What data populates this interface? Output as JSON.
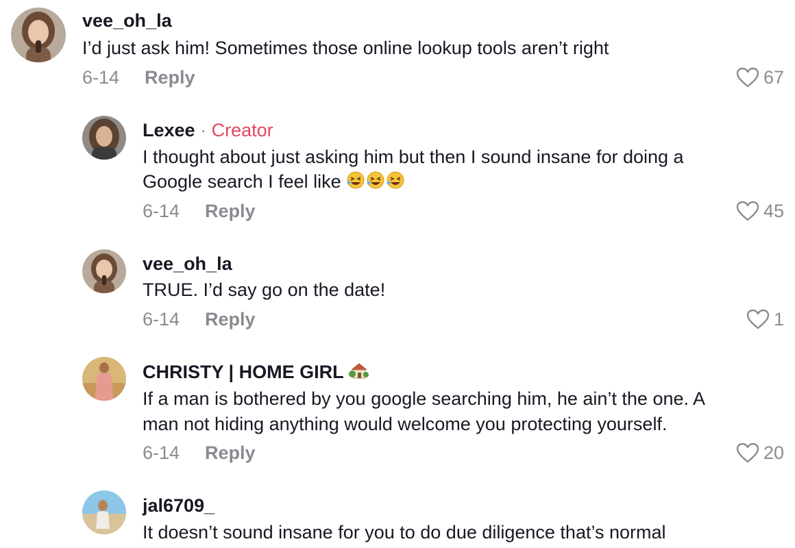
{
  "comments": [
    {
      "username": "vee_oh_la",
      "text": "I’d just ask him! Sometimes those online lookup tools aren’t right",
      "date": "6-14",
      "reply_label": "Reply",
      "likes": "67"
    },
    {
      "username": "Lexee",
      "separator": "·",
      "badge": "Creator",
      "text_line1": "I thought about just asking him but then I sound insane for doing a",
      "text_line2": "Google search I feel like",
      "emoji": "🤣🤣🤣",
      "date": "6-14",
      "reply_label": "Reply",
      "likes": "45"
    },
    {
      "username": "vee_oh_la",
      "text": "TRUE. I’d say go on the date!",
      "date": "6-14",
      "reply_label": "Reply",
      "likes": "1"
    },
    {
      "username": "CHRISTY | HOME GIRL",
      "username_emoji": "🏡",
      "text_line1": "If a man is bothered by you google searching him, he ain’t the one. A",
      "text_line2": "man not hiding anything would welcome you protecting yourself.",
      "date": "6-14",
      "reply_label": "Reply",
      "likes": "20"
    },
    {
      "username": "jal6709_",
      "text": "It doesn’t sound insane for you to do due diligence that’s normal"
    }
  ],
  "colors": {
    "primary_text": "#161823",
    "secondary_text": "#8a8b91",
    "creator_badge": "#e64660",
    "background": "#ffffff"
  },
  "icons": {
    "like": "heart-outline-icon",
    "laugh_emoji": "rolling-on-floor-laughing",
    "house_emoji": "house-with-garden"
  }
}
